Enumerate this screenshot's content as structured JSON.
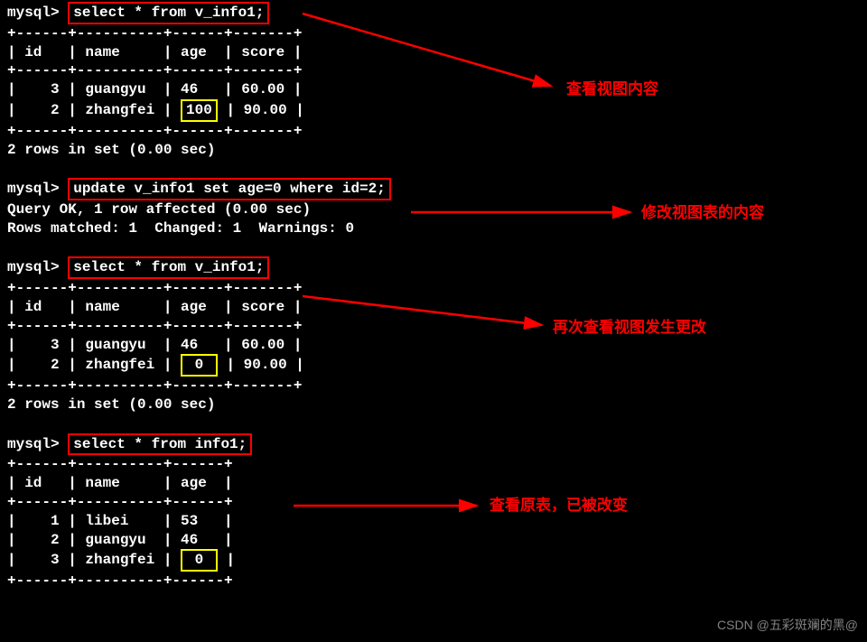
{
  "prompt": "mysql>",
  "cmd1": "select * from v_info1;",
  "table1": {
    "sep": "+------+----------+------+-------+",
    "header": "| id   | name     | age  | score |",
    "row1_pre": "|    3 | guangyu  | 46   | 60.00 |",
    "row2_pre": "|    2 | zhangfei |",
    "row2_highlight": "100",
    "row2_post": "| 90.00 |"
  },
  "result1": "2 rows in set (0.00 sec)",
  "cmd2": "update v_info1 set age=0 where id=2;",
  "result2_l1": "Query OK, 1 row affected (0.00 sec)",
  "result2_l2": "Rows matched: 1  Changed: 1  Warnings: 0",
  "cmd3": "select * from v_info1;",
  "table3": {
    "sep": "+------+----------+------+-------+",
    "header": "| id   | name     | age  | score |",
    "row1": "|    3 | guangyu  | 46   | 60.00 |",
    "row2_pre": "|    2 | zhangfei |",
    "row2_highlight": " 0 ",
    "row2_post": " | 90.00 |"
  },
  "result3": "2 rows in set (0.00 sec)",
  "cmd4": "select * from info1;",
  "table4": {
    "sep": "+------+----------+------+",
    "header": "| id   | name     | age  |",
    "row1": "|    1 | libei    | 53   |",
    "row2": "|    2 | guangyu  | 46   |",
    "row3_pre": "|    3 | zhangfei |",
    "row3_highlight": " 0 ",
    "row3_post": " |"
  },
  "annotations": {
    "a1": "查看视图内容",
    "a2": "修改视图表的内容",
    "a3": "再次查看视图发生更改",
    "a4": "查看原表，已被改变"
  },
  "watermark": "CSDN @五彩斑斓的黑@"
}
